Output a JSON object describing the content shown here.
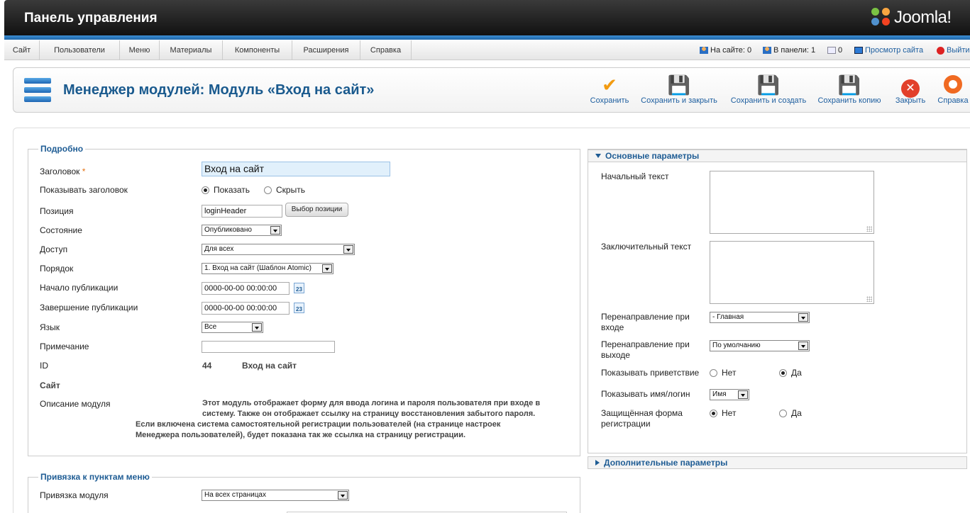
{
  "header": {
    "title": "Панель управления",
    "logo_text": "Joomla!"
  },
  "menu": [
    "Сайт",
    "Пользователи",
    "Меню",
    "Материалы",
    "Компоненты",
    "Расширения",
    "Справка"
  ],
  "status": {
    "on_site": "На сайте: 0",
    "in_panel": "В панели: 1",
    "messages": "0",
    "view_site": "Просмотр сайта",
    "logout": "Выйти"
  },
  "toolbar": {
    "page_title": "Менеджер модулей: Модуль «Вход на сайт»",
    "buttons": [
      "Сохранить",
      "Сохранить и закрыть",
      "Сохранить и создать",
      "Сохранить копию",
      "Закрыть",
      "Справка"
    ]
  },
  "details": {
    "legend": "Подробно",
    "title_label": "Заголовок",
    "title_value": "Вход на сайт",
    "show_title_label": "Показывать заголовок",
    "show": "Показать",
    "hide": "Скрыть",
    "position_label": "Позиция",
    "position_value": "loginHeader",
    "position_button": "Выбор позиции",
    "state_label": "Состояние",
    "state_value": "Опубликовано",
    "access_label": "Доступ",
    "access_value": "Для всех",
    "order_label": "Порядок",
    "order_value": "1. Вход на сайт (Шаблон Atomic)",
    "publish_up_label": "Начало публикации",
    "publish_up_value": "0000-00-00 00:00:00",
    "publish_down_label": "Завершение публикации",
    "publish_down_value": "0000-00-00 00:00:00",
    "calendar_day": "23",
    "language_label": "Язык",
    "language_value": "Все",
    "note_label": "Примечание",
    "note_value": "",
    "id_label": "ID",
    "id_value": "44",
    "id_name": "Вход на сайт",
    "site_label": "Сайт",
    "description_label": "Описание модуля",
    "description_line1": "Этот модуль отображает форму для ввода логина и пароля пользователя при входе в",
    "description_line2": "систему. Также он отображает ссылку на страницу восстановления забытого пароля.",
    "description_line3": "Если включена система самостоятельной регистрации пользователей (на странице настроек",
    "description_line4": "Менеджера пользователей), будет показана так же ссылка на страницу регистрации."
  },
  "menu_assignment": {
    "legend": "Привязка к пунктам меню",
    "label": "Привязка модуля",
    "value": "На всех страницах"
  },
  "basic": {
    "title": "Основные параметры",
    "pretext_label": "Начальный текст",
    "posttext_label": "Заключительный текст",
    "login_redirect_label_1": "Перенаправление при",
    "login_redirect_label_2": "входе",
    "login_redirect_value": "- Главная",
    "logout_redirect_label_1": "Перенаправление при",
    "logout_redirect_label_2": "выходе",
    "logout_redirect_value": "По умолчанию",
    "greeting_label": "Показывать приветствие",
    "no": "Нет",
    "yes": "Да",
    "name_label": "Показывать имя/логин",
    "name_value": "Имя",
    "secure_label_1": "Защищённая форма",
    "secure_label_2": "регистрации"
  },
  "advanced": {
    "title": "Дополнительные параметры"
  }
}
